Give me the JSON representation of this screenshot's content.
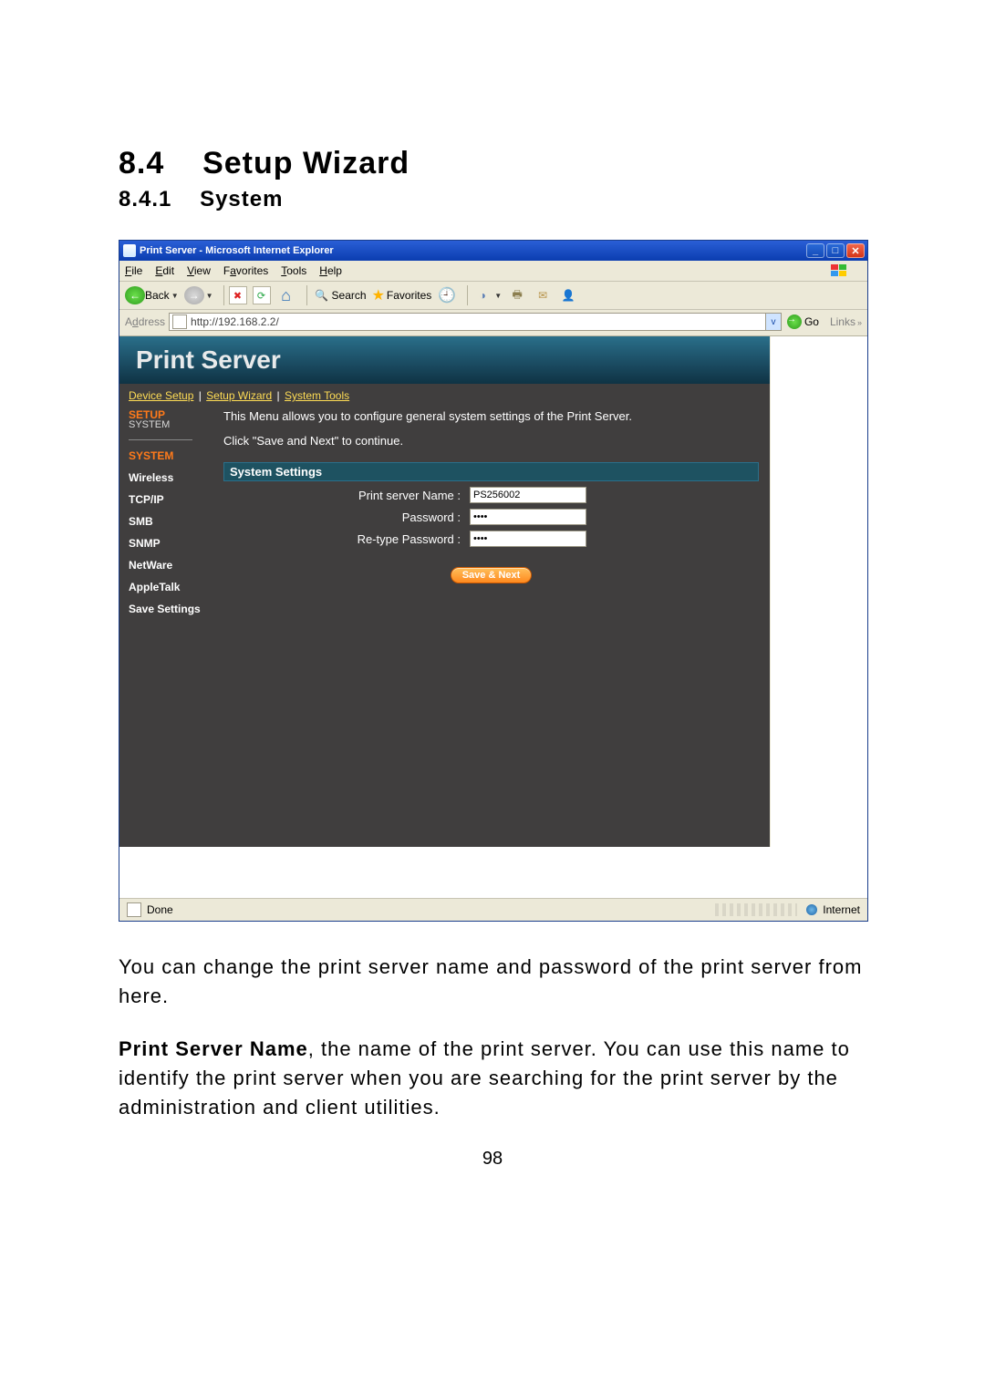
{
  "doc": {
    "section_number": "8.4",
    "section_title": "Setup Wizard",
    "subsection_number": "8.4.1",
    "subsection_title": "System",
    "para1": "You can change the print server name and password of the print server from here.",
    "para2_bold": "Print Server Name",
    "para2_rest": ", the name of the print server. You can use this name to identify the print server when you are searching for the print server by the administration and client utilities.",
    "page_number": "98"
  },
  "ie": {
    "title": "Print Server - Microsoft Internet Explorer",
    "menus": {
      "file": "File",
      "edit": "Edit",
      "view": "View",
      "favorites": "Favorites",
      "tools": "Tools",
      "help": "Help"
    },
    "toolbar": {
      "back": "Back",
      "search": "Search",
      "favorites": "Favorites"
    },
    "address_label": "Address",
    "address_url": "http://192.168.2.2/",
    "go": "Go",
    "links": "Links",
    "status_done": "Done",
    "status_zone": "Internet"
  },
  "ps": {
    "banner": "Print Server",
    "crumbs": {
      "device": "Device Setup",
      "wizard": "Setup Wizard",
      "tools": "System Tools"
    },
    "sidebar": {
      "head": "SETUP",
      "subhead": "SYSTEM",
      "system": "SYSTEM",
      "wireless": "Wireless",
      "tcpip": "TCP/IP",
      "smb": "SMB",
      "snmp": "SNMP",
      "netware": "NetWare",
      "appletalk": "AppleTalk",
      "save": "Save Settings"
    },
    "main": {
      "intro": "This Menu allows you to configure general system settings of the Print Server.",
      "continue": "Click \"Save and Next\" to continue.",
      "section": "System Settings",
      "name_label": "Print server Name :",
      "name_value": "PS256002",
      "pw_label": "Password :",
      "pw_value": "••••",
      "rpw_label": "Re-type Password :",
      "rpw_value": "••••",
      "button": "Save & Next"
    }
  }
}
